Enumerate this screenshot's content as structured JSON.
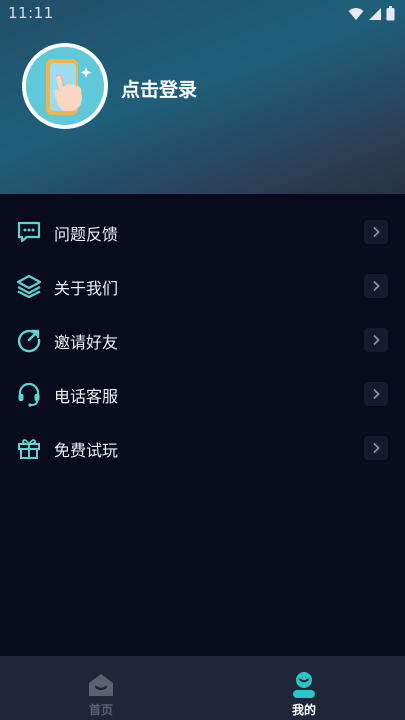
{
  "status": {
    "time": "11:11"
  },
  "profile": {
    "login_label": "点击登录"
  },
  "menu": {
    "items": [
      {
        "label": "问题反馈",
        "icon": "chat-bubble-icon"
      },
      {
        "label": "关于我们",
        "icon": "layers-icon"
      },
      {
        "label": "邀请好友",
        "icon": "refresh-arrow-icon"
      },
      {
        "label": "电话客服",
        "icon": "headset-icon"
      },
      {
        "label": "免费试玩",
        "icon": "gift-icon"
      }
    ]
  },
  "tabbar": {
    "tabs": [
      {
        "label": "首页",
        "active": false
      },
      {
        "label": "我的",
        "active": true
      }
    ]
  },
  "colors": {
    "accent": "#2ec4c6",
    "icon_teal": "#5fd3d2",
    "inactive": "#5a6272",
    "background": "#080b1c"
  }
}
